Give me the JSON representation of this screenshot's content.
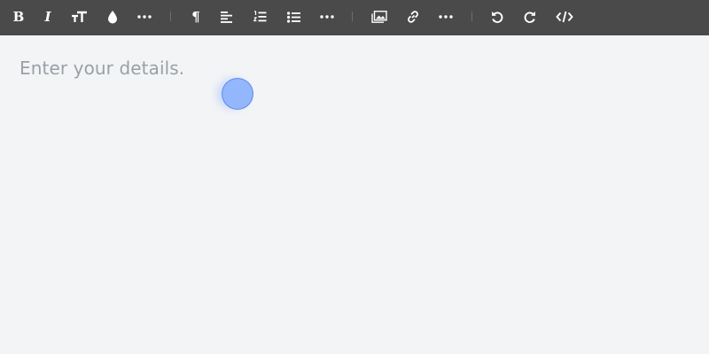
{
  "toolbar": {
    "background": "#4a4a4a",
    "buttons": [
      {
        "icon": "bold-icon",
        "glyph": "B"
      },
      {
        "icon": "italic-icon",
        "glyph": "I"
      },
      {
        "icon": "font-size-icon"
      },
      {
        "icon": "text-color-icon"
      },
      {
        "icon": "more-icon"
      },
      {
        "icon": "paragraph-icon",
        "glyph": "¶"
      },
      {
        "icon": "align-left-icon"
      },
      {
        "icon": "ordered-list-icon"
      },
      {
        "icon": "unordered-list-icon"
      },
      {
        "icon": "more-icon"
      },
      {
        "icon": "insert-image-icon"
      },
      {
        "icon": "insert-link-icon"
      },
      {
        "icon": "more-icon"
      },
      {
        "icon": "undo-icon"
      },
      {
        "icon": "redo-icon"
      },
      {
        "icon": "code-view-icon"
      }
    ]
  },
  "editor": {
    "placeholder": "Enter your details.",
    "background": "#f3f4f6",
    "placeholder_color": "#9aa0a6"
  },
  "cursor": {
    "icon": "touch-cursor-icon",
    "color": "#6e9eff"
  }
}
